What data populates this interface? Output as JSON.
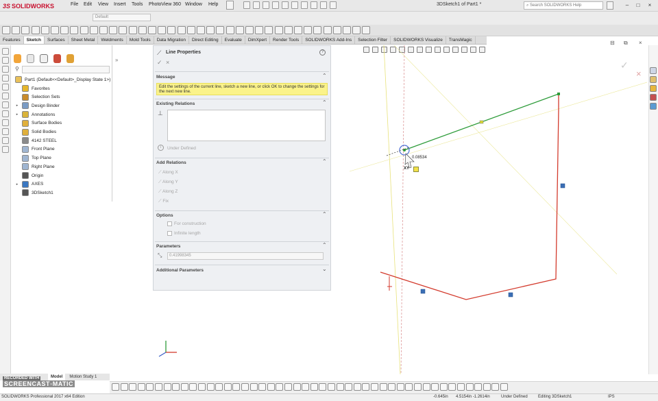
{
  "app": {
    "logo_text": "SOLIDWORKS",
    "logo_mark": "3S",
    "menus": [
      "File",
      "Edit",
      "View",
      "Insert",
      "Tools",
      "PhotoView 360",
      "Window",
      "Help"
    ],
    "document_title": "3DSketch1 of Part1 *",
    "help_search_placeholder": "Search SOLIDWORKS Help",
    "window_buttons": [
      "–",
      "□",
      "×"
    ],
    "config_select_value": "Default"
  },
  "tabs": [
    "Features",
    "Sketch",
    "Surfaces",
    "Sheet Metal",
    "Weldments",
    "Mold Tools",
    "Data Migration",
    "Direct Editing",
    "Evaluate",
    "DimXpert",
    "Render Tools",
    "SOLIDWORKS Add-Ins",
    "Selection Filter",
    "SOLIDWORKS Visualize",
    "TransMagic"
  ],
  "active_tab": "Sketch",
  "feature_tree": {
    "root": "Part1  (Default<<Default>_Display State 1>)",
    "items": [
      {
        "label": "Favorites",
        "expandable": false,
        "icon": "favorites-icon",
        "color": "#e6b62a"
      },
      {
        "label": "Selection Sets",
        "expandable": false,
        "icon": "selection-sets-icon",
        "color": "#c98b2b"
      },
      {
        "label": "Design Binder",
        "expandable": true,
        "icon": "design-binder-icon",
        "color": "#7a9bc4"
      },
      {
        "label": "Annotations",
        "expandable": true,
        "icon": "annotations-icon",
        "color": "#d9b33a"
      },
      {
        "label": "Surface Bodies",
        "expandable": false,
        "icon": "surface-bodies-icon",
        "color": "#e0b03c"
      },
      {
        "label": "Solid Bodies",
        "expandable": false,
        "icon": "solid-bodies-icon",
        "color": "#e0b03c"
      },
      {
        "label": "4142 STEEL",
        "expandable": false,
        "icon": "material-icon",
        "color": "#8a8a8a"
      },
      {
        "label": "Front Plane",
        "expandable": false,
        "icon": "plane-icon",
        "color": "#9fb5d1"
      },
      {
        "label": "Top Plane",
        "expandable": false,
        "icon": "plane-icon",
        "color": "#9fb5d1"
      },
      {
        "label": "Right Plane",
        "expandable": false,
        "icon": "plane-icon",
        "color": "#9fb5d1"
      },
      {
        "label": "Origin",
        "expandable": false,
        "icon": "origin-icon",
        "color": "#555555"
      },
      {
        "label": "AXES",
        "expandable": true,
        "icon": "folder-icon",
        "color": "#3b78c2"
      },
      {
        "label": "3DSketch1",
        "expandable": false,
        "icon": "3dsketch-icon",
        "color": "#555555"
      }
    ]
  },
  "property_manager": {
    "title": "Line Properties",
    "ok_symbol": "✓",
    "cancel_symbol": "×",
    "help_symbol": "?",
    "message_header": "Message",
    "message_text": "Edit the settings of the current line, sketch a new line, or click OK to change the settings for the next new line.",
    "existing_relations_header": "Existing Relations",
    "status_text": "Under Defined",
    "add_relations_header": "Add Relations",
    "relations": [
      "Along X",
      "Along Y",
      "Along Z",
      "Fix"
    ],
    "options_header": "Options",
    "options": [
      "For construction",
      "Infinite length"
    ],
    "parameters_header": "Parameters",
    "parameter_value": "0.41998345",
    "additional_params_header": "Additional Parameters",
    "chevron_up": "⌃",
    "chevron_down": "⌄"
  },
  "graphics": {
    "cursor_readout": "0.08534",
    "cursor_label": "XY",
    "line_colors": {
      "active_line": "#2e9c3a",
      "sketch_lines": "#d33a2c",
      "axis_lines": "#e8e27a",
      "vertical_axis": "#d88a8a",
      "handle": "#3b6fb5"
    }
  },
  "bottom_tabs": [
    "Model",
    "Motion Study 1"
  ],
  "active_bottom_tab": "Model",
  "watermark": {
    "line1": "RECORDED WITH",
    "line2": "SCREENCAST◦MATIC"
  },
  "status": {
    "edition": "SOLIDWORKS Professional 2017 x64 Edition",
    "x": "-0.645in",
    "yz": "4.5154in  -1.2614in",
    "state": "Under Defined",
    "editing": "Editing 3DSketch1",
    "units": "IPS"
  }
}
